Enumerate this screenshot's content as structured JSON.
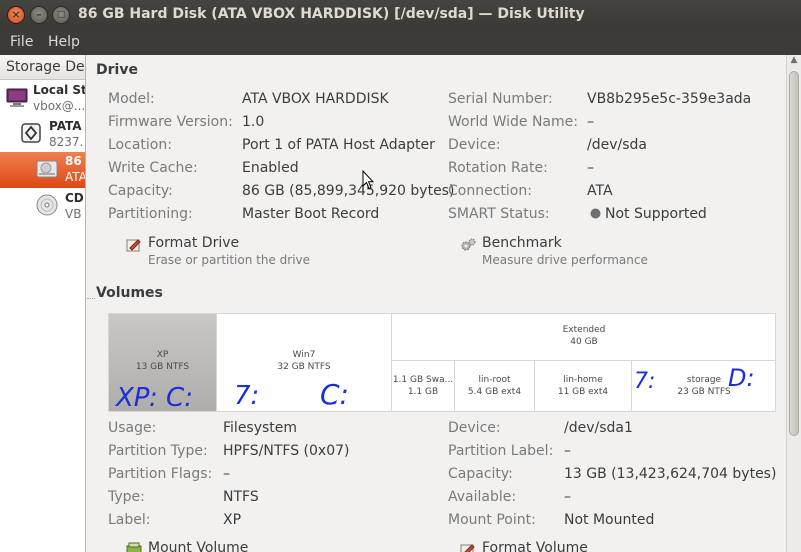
{
  "window": {
    "title": "86 GB Hard Disk (ATA VBOX HARDDISK) [/dev/sda] — Disk Utility",
    "close_glyph": "×",
    "minimize_glyph": "–",
    "maximize_glyph": "□"
  },
  "menu": {
    "file": "File",
    "help": "Help"
  },
  "sidebar": {
    "header": "Storage De",
    "items": [
      {
        "title": "Local Sto",
        "subtitle": "vbox@...",
        "icon": "computer-icon"
      },
      {
        "title": "PATA",
        "subtitle": "8237.",
        "icon": "controller-icon"
      },
      {
        "title": "86",
        "subtitle": "ATA",
        "icon": "harddisk-icon",
        "selected": true
      },
      {
        "title": "CD",
        "subtitle": "VB",
        "icon": "optical-disc-icon"
      }
    ]
  },
  "drive": {
    "heading": "Drive",
    "left": [
      {
        "label": "Model:",
        "value": "ATA VBOX HARDDISK"
      },
      {
        "label": "Firmware Version:",
        "value": "1.0"
      },
      {
        "label": "Location:",
        "value": "Port 1 of PATA Host Adapter"
      },
      {
        "label": "Write Cache:",
        "value": "Enabled"
      },
      {
        "label": "Capacity:",
        "value": "86 GB (85,899,345,920 bytes)"
      },
      {
        "label": "Partitioning:",
        "value": "Master Boot Record"
      }
    ],
    "right": [
      {
        "label": "Serial Number:",
        "value": "VB8b295e5c-359e3ada"
      },
      {
        "label": "World Wide Name:",
        "value": "–"
      },
      {
        "label": "Device:",
        "value": "/dev/sda"
      },
      {
        "label": "Rotation Rate:",
        "value": "–"
      },
      {
        "label": "Connection:",
        "value": "ATA"
      },
      {
        "label": "SMART Status:",
        "value": "Not Supported"
      }
    ],
    "actions": {
      "format": {
        "title": "Format Drive",
        "subtitle": "Erase or partition the drive"
      },
      "benchmark": {
        "title": "Benchmark",
        "subtitle": "Measure drive performance"
      }
    }
  },
  "volumes": {
    "heading": "Volumes",
    "map": {
      "xp": {
        "name": "XP",
        "size": "13 GB NTFS"
      },
      "win7": {
        "name": "Win7",
        "size": "32 GB NTFS"
      },
      "extended": {
        "name": "Extended",
        "size": "40 GB"
      },
      "swap": {
        "name": "1.1 GB Swa...",
        "size": "1.1 GB"
      },
      "linroot": {
        "name": "lin-root",
        "size": "5.4 GB ext4"
      },
      "linhome": {
        "name": "lin-home",
        "size": "11 GB ext4"
      },
      "storage": {
        "name": "storage",
        "size": "23 GB NTFS"
      }
    },
    "annotations": {
      "xp": "XP: C:",
      "win7_seven": "7:",
      "win7_c": "C:",
      "storage_seven": "7:",
      "storage_d": "D:"
    },
    "left": [
      {
        "label": "Usage:",
        "value": "Filesystem"
      },
      {
        "label": "Partition Type:",
        "value": "HPFS/NTFS (0x07)"
      },
      {
        "label": "Partition Flags:",
        "value": "–"
      },
      {
        "label": "Type:",
        "value": "NTFS"
      },
      {
        "label": "Label:",
        "value": "XP"
      }
    ],
    "right": [
      {
        "label": "Device:",
        "value": "/dev/sda1"
      },
      {
        "label": "Partition Label:",
        "value": "–"
      },
      {
        "label": "Capacity:",
        "value": "13 GB (13,423,624,704 bytes)"
      },
      {
        "label": "Available:",
        "value": "–"
      },
      {
        "label": "Mount Point:",
        "value": "Not Mounted"
      }
    ],
    "actions": {
      "mount": {
        "title": "Mount Volume"
      },
      "format": {
        "title": "Format Volume"
      }
    }
  },
  "colors": {
    "selection": "#dd4814",
    "annotation_ink": "#1a2fd6"
  }
}
